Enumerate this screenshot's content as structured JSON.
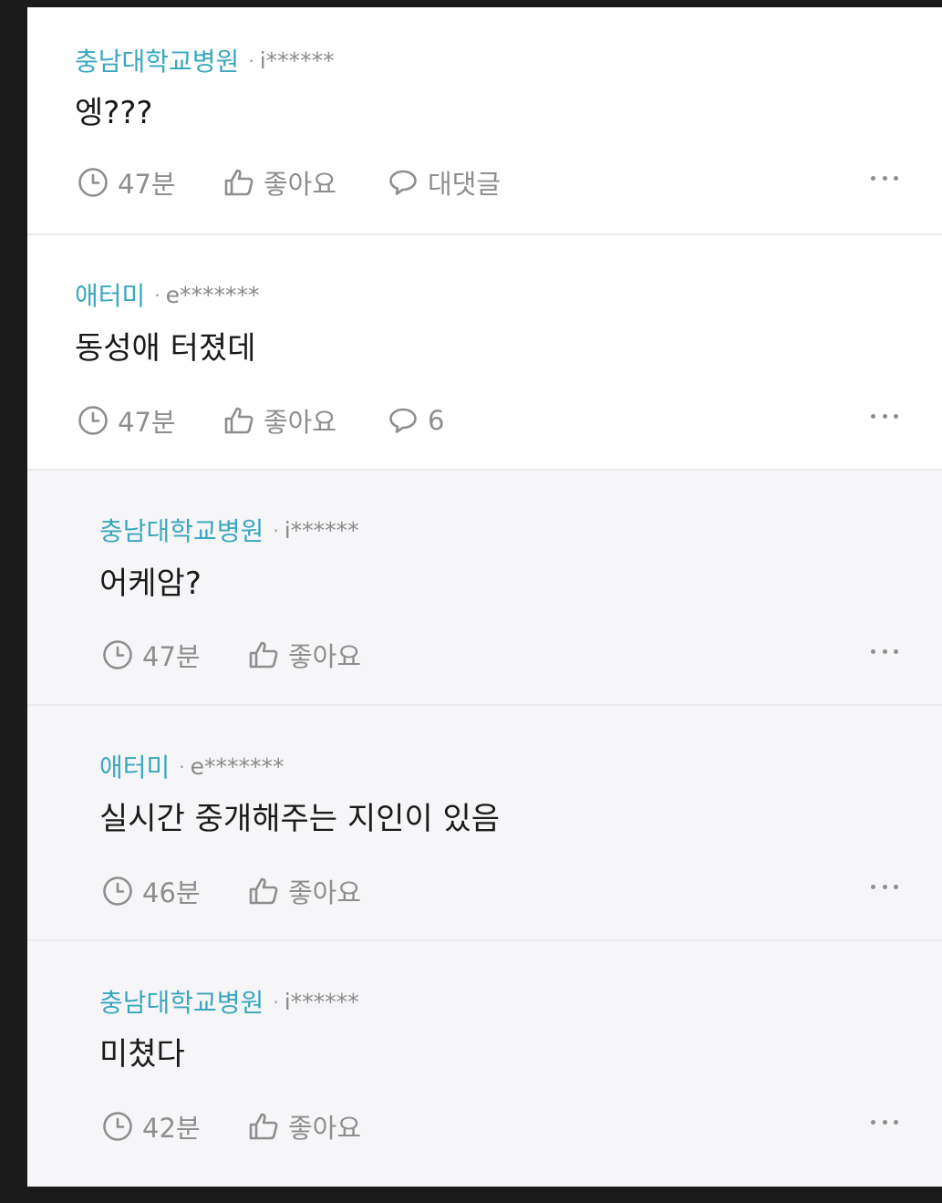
{
  "comments": [
    {
      "author": "충남대학교병원",
      "uid": "i******",
      "text": "엥???",
      "time": "47분",
      "like": "좋아요",
      "reply": "대댓글"
    },
    {
      "author": "애터미",
      "uid": "e*******",
      "text": "동성애 터졌데",
      "time": "47분",
      "like": "좋아요",
      "reply": "6"
    }
  ],
  "replies": [
    {
      "author": "충남대학교병원",
      "uid": "i******",
      "text": "어케암?",
      "time": "47분",
      "like": "좋아요"
    },
    {
      "author": "애터미",
      "uid": "e*******",
      "text": "실시간 중개해주는 지인이 있음",
      "time": "46분",
      "like": "좋아요"
    },
    {
      "author": "충남대학교병원",
      "uid": "i******",
      "text": "미쳤다",
      "time": "42분",
      "like": "좋아요"
    }
  ],
  "separator": "·",
  "icons": {
    "time": "clock-icon",
    "like": "thumbs-up-icon",
    "reply": "speech-bubble-icon",
    "more": "more-options-icon"
  },
  "colors": {
    "author": "#3aa7c0",
    "meta": "#8e8e8e",
    "reply_background": "#f6f6f8"
  }
}
